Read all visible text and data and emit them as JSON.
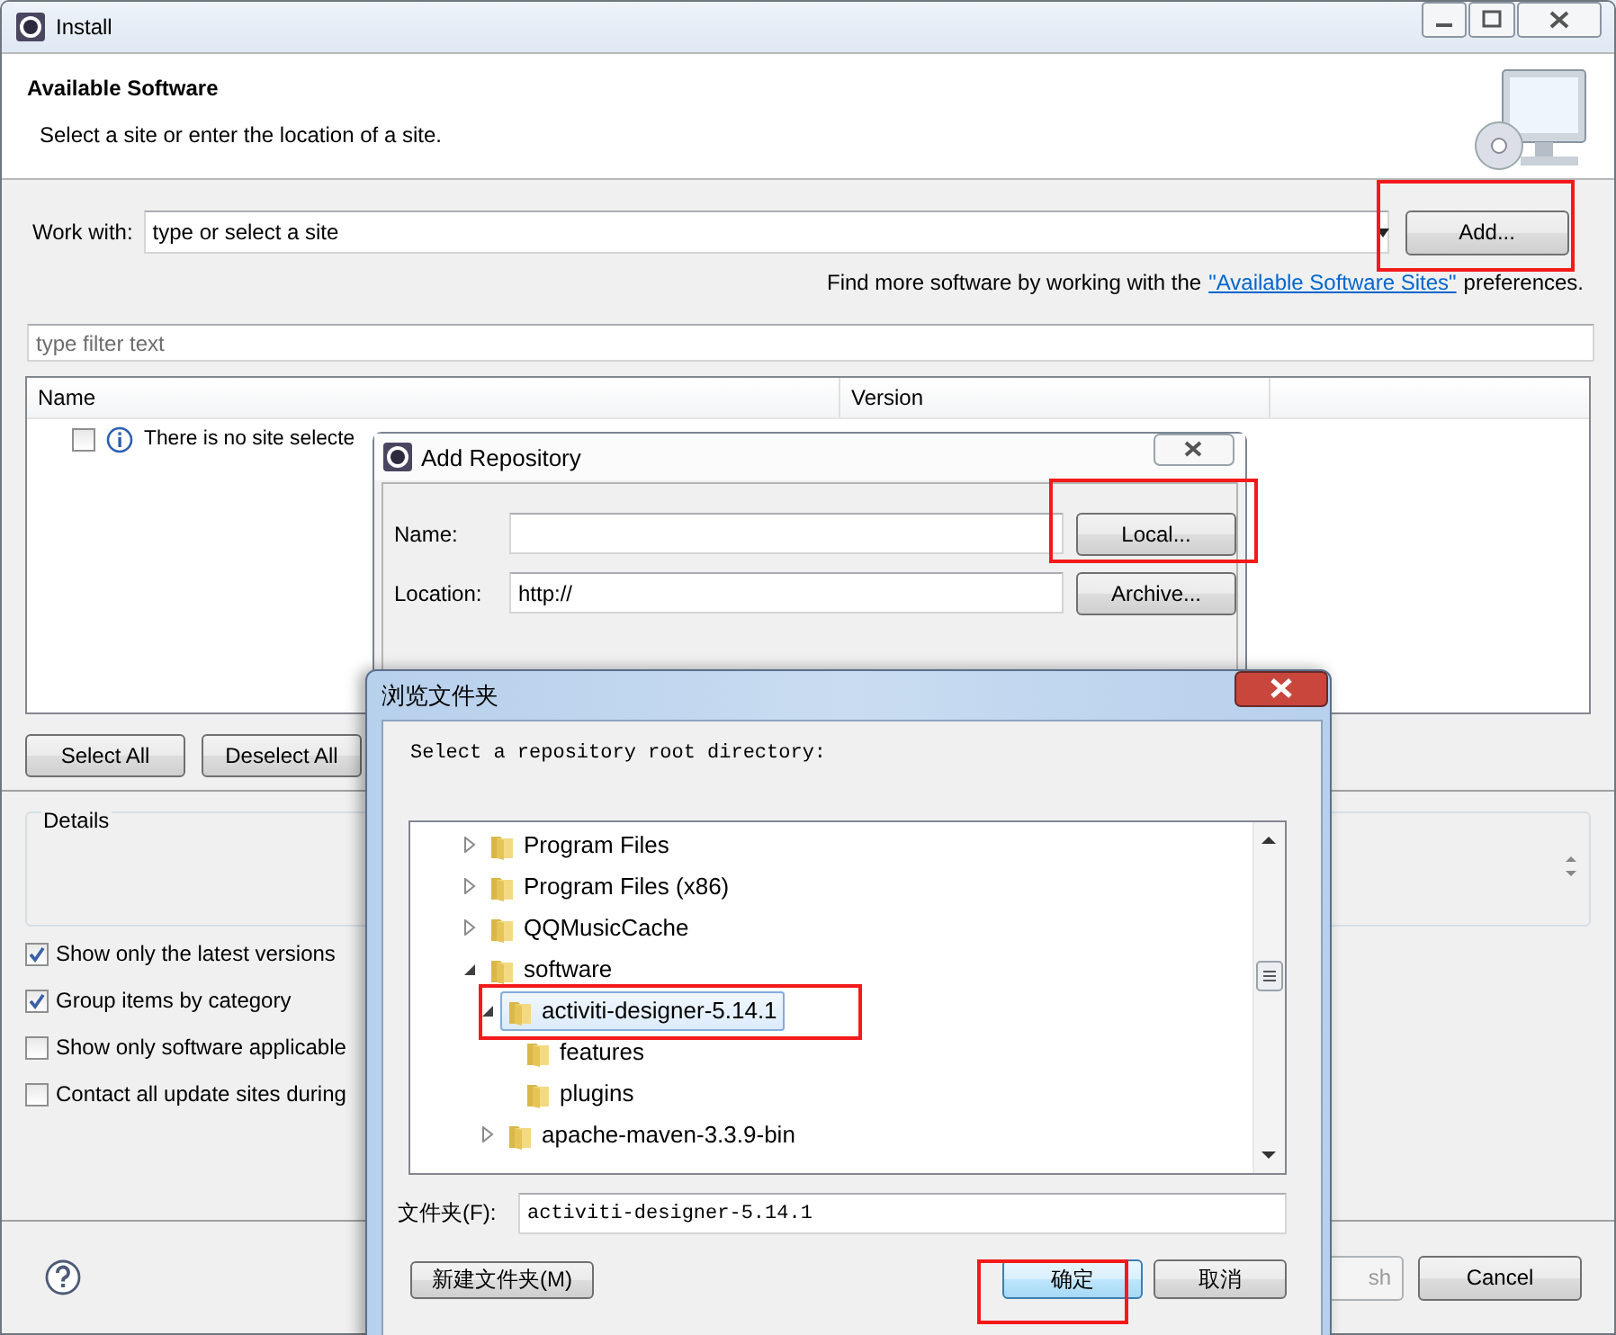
{
  "window": {
    "title": "Install"
  },
  "header": {
    "title": "Available Software",
    "subtitle": "Select a site or enter the location of a site."
  },
  "work_with": {
    "label": "Work with:",
    "value": "type or select a site",
    "button": {
      "label": "Add...",
      "highlighted": true
    }
  },
  "find_more": {
    "before": "Find more software by working with the",
    "link": "\"Available Software Sites\"",
    "after": "preferences."
  },
  "filter": {
    "placeholder": "type filter text"
  },
  "table": {
    "columns": [
      "Name",
      "Version"
    ],
    "rows": [
      {
        "text": "There is no site selecte",
        "checked": false
      }
    ]
  },
  "selection_buttons": [
    "Select All",
    "Deselect All"
  ],
  "details": {
    "title": "Details"
  },
  "options": [
    {
      "label": "Show only the latest versions",
      "checked": true
    },
    {
      "label": "Group items by category",
      "checked": true
    },
    {
      "label": "Show only software applicable",
      "checked": false
    },
    {
      "label": "Contact all update sites during",
      "checked": false
    }
  ],
  "footer_buttons": [
    {
      "label": "sh",
      "disabled": true
    },
    {
      "label": "Cancel",
      "disabled": false
    }
  ],
  "add_repository": {
    "title": "Add Repository",
    "name_label": "Name:",
    "location_label": "Location:",
    "location_value": "http://",
    "buttons": [
      {
        "label": "Local...",
        "highlighted": true
      },
      {
        "label": "Archive...",
        "highlighted": false
      }
    ]
  },
  "browse_folder": {
    "title": "浏览文件夹",
    "prompt": "Select a repository root directory:",
    "tree": [
      {
        "label": "Program Files",
        "expandable": true,
        "expanded": false,
        "selected": false
      },
      {
        "label": "Program Files (x86)",
        "expandable": true,
        "expanded": false,
        "selected": false
      },
      {
        "label": "QQMusicCache",
        "expandable": true,
        "expanded": false,
        "selected": false
      },
      {
        "label": "software",
        "expandable": true,
        "expanded": true,
        "selected": false,
        "children": [
          {
            "label": "activiti-designer-5.14.1",
            "expandable": true,
            "expanded": true,
            "selected": true,
            "highlighted": true,
            "children": [
              {
                "label": "features",
                "expandable": false,
                "expanded": false,
                "selected": false
              },
              {
                "label": "plugins",
                "expandable": false,
                "expanded": false,
                "selected": false
              }
            ]
          },
          {
            "label": "apache-maven-3.3.9-bin",
            "expandable": true,
            "expanded": false,
            "selected": false
          }
        ]
      }
    ],
    "folder_label": "文件夹(F):",
    "folder_value": "activiti-designer-5.14.1",
    "buttons": [
      {
        "label": "新建文件夹(M)",
        "default": false,
        "highlighted": false
      },
      {
        "label": "确定",
        "default": true,
        "highlighted": true
      },
      {
        "label": "取消",
        "default": false,
        "highlighted": false
      }
    ]
  }
}
